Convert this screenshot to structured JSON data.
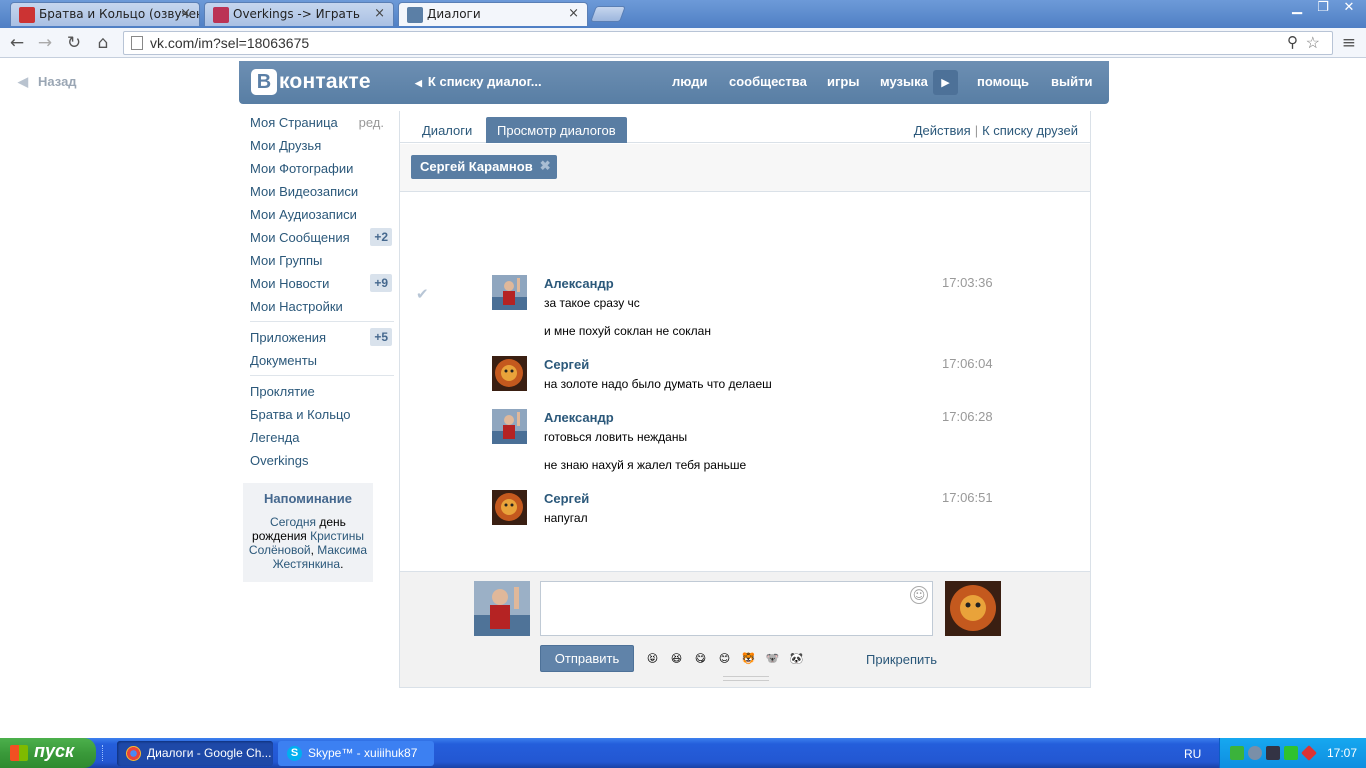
{
  "browser": {
    "tabs": [
      {
        "label": "Братва и Кольцо (озвучено",
        "close": "×"
      },
      {
        "label": "Overkings -> Играть",
        "close": "×"
      },
      {
        "label": "Диалоги",
        "close": "×"
      }
    ],
    "window_buttons": {
      "minimize": "▁",
      "maximize": "❐",
      "close": "✕"
    },
    "url": "vk.com/im?sel=18063675"
  },
  "page": {
    "back_label": "Назад",
    "header": {
      "logo_letter": "В",
      "logo_text": "контакте",
      "back_to_list": "К списку диалог...",
      "nav": [
        "люди",
        "сообщества",
        "игры",
        "музыка",
        "помощь",
        "выйти"
      ]
    },
    "left_menu": {
      "edit": "ред.",
      "items": [
        {
          "label": "Моя Страница"
        },
        {
          "label": "Мои Друзья"
        },
        {
          "label": "Мои Фотографии"
        },
        {
          "label": "Мои Видеозаписи"
        },
        {
          "label": "Мои Аудиозаписи"
        },
        {
          "label": "Мои Сообщения",
          "badge": "+2"
        },
        {
          "label": "Мои Группы"
        },
        {
          "label": "Мои Новости",
          "badge": "+9"
        },
        {
          "label": "Мои Настройки"
        }
      ],
      "apps": [
        {
          "label": "Приложения",
          "badge": "+5"
        },
        {
          "label": "Документы"
        }
      ],
      "groups": [
        "Проклятие",
        "Братва и Кольцо",
        "Легенда",
        "Overkings"
      ]
    },
    "reminder": {
      "title": "Напоминание",
      "today": "Сегодня",
      "text1": " день рождения ",
      "person1": "Кристины Солёновой",
      "comma": ", ",
      "person2": "Максима Жестянкина",
      "dot": "."
    },
    "tabs": {
      "dialogs": "Диалоги",
      "view": "Просмотр диалогов",
      "actions": "Действия",
      "separator": "|",
      "friends": "К списку друзей"
    },
    "peer": {
      "name": "Сергей Карамнов",
      "remove": "✖"
    },
    "messages": [
      {
        "author": "Александр",
        "time": "17:03:36",
        "lines": [
          "за такое сразу чс",
          "и мне похуй соклан не соклан"
        ]
      },
      {
        "author": "Сергей",
        "time": "17:06:04",
        "lines": [
          "на золоте надо было думать что делаеш"
        ]
      },
      {
        "author": "Александр",
        "time": "17:06:28",
        "lines": [
          "готовься ловить нежданы",
          "не знаю нахуй я жалел тебя раньше"
        ]
      },
      {
        "author": "Сергей",
        "time": "17:06:51",
        "lines": [
          "напугал"
        ]
      }
    ],
    "composer": {
      "send": "Отправить",
      "attach": "Прикрепить",
      "emojis": [
        "😝",
        "😆",
        "😋",
        "😊",
        "🐯",
        "🐨",
        "🐼"
      ]
    }
  },
  "taskbar": {
    "start": "пуск",
    "tasks": [
      {
        "label": "Диалоги - Google Ch..."
      },
      {
        "label": "Skype™ - xuiiihuk87"
      }
    ],
    "lang": "RU",
    "clock": "17:07"
  },
  "colors": {
    "vk_blue": "#597da3",
    "link": "#2b587a",
    "xp_taskbar": "#245edb"
  }
}
